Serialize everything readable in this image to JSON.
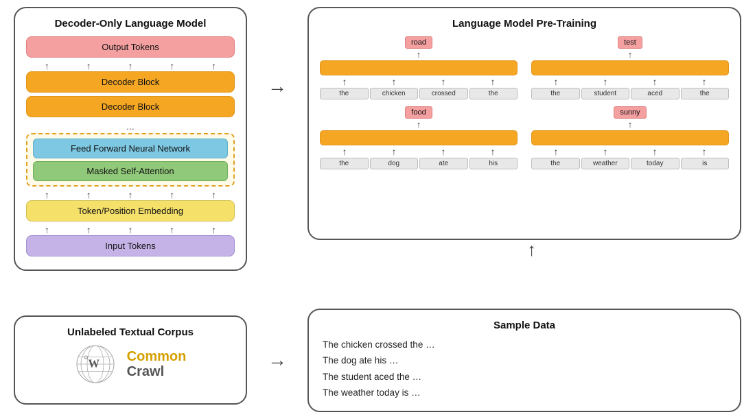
{
  "decoder": {
    "title": "Decoder-Only Language Model",
    "layers": {
      "output_tokens": "Output Tokens",
      "decoder_block_1": "Decoder Block",
      "decoder_block_2": "Decoder Block",
      "dots": "...",
      "ffnn": "Feed Forward Neural Network",
      "msa": "Masked Self-Attention",
      "embedding": "Token/Position Embedding",
      "input_tokens": "Input Tokens"
    }
  },
  "pretraining": {
    "title": "Language Model Pre-Training",
    "example1": {
      "target": "road",
      "input_words": [
        "the",
        "chicken",
        "crossed",
        "the"
      ]
    },
    "example2": {
      "target": "food",
      "input_words": [
        "the",
        "dog",
        "ate",
        "his"
      ]
    },
    "example3": {
      "target": "test",
      "input_words": [
        "the",
        "student",
        "aced",
        "the"
      ]
    },
    "example4": {
      "target": "sunny",
      "input_words": [
        "the",
        "weather",
        "today",
        "is"
      ]
    }
  },
  "corpus": {
    "title": "Unlabeled Textual Corpus",
    "common_label": "Common",
    "crawl_label": "Crawl"
  },
  "sample_data": {
    "title": "Sample Data",
    "lines": [
      "The chicken crossed the …",
      "The dog ate his …",
      "The student aced the …",
      "The weather today is …"
    ]
  }
}
